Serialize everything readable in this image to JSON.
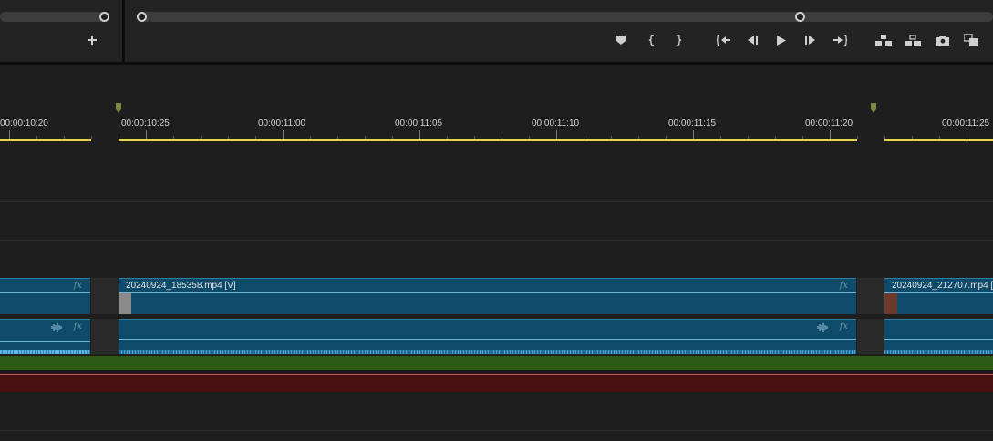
{
  "timecodes": [
    "00:00:10:20",
    "00:00:10:25",
    "00:00:11:00",
    "00:00:11:05",
    "00:00:11:10",
    "00:00:11:15",
    "00:00:11:20",
    "00:00:11:25"
  ],
  "clips": {
    "video_left_name": "",
    "video_main_name": "20240924_185358.mp4 [V]",
    "video_right_name": "20240924_212707.mp4 [",
    "fx_label": "fx"
  },
  "toolbar": {
    "add_icon": "plus-icon",
    "buttons": [
      "add-marker",
      "mark-in",
      "mark-out",
      "go-to-in",
      "step-back",
      "play",
      "step-forward",
      "go-to-out",
      "lift",
      "extract",
      "export-frame",
      "comparison-view"
    ]
  },
  "colors": {
    "work_area": "#e6d84a",
    "clip_fill": "#0e4a6a",
    "audio_green": "#2f5a14",
    "audio_red": "#4a0f0f"
  }
}
